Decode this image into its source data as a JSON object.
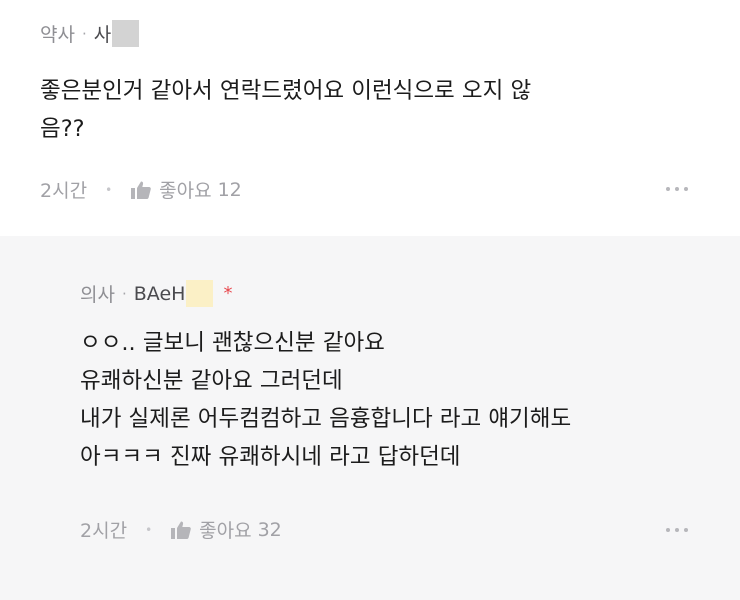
{
  "comment": {
    "role": "약사",
    "nickname": "사",
    "body_lines": [
      "좋은분인거 같아서 연락드렸어요  이런식으로 오지 않",
      "음??"
    ],
    "time": "2시간",
    "like_label": "좋아요",
    "like_count": "12"
  },
  "reply": {
    "role": "의사",
    "nickname": "BAeH",
    "author_mark": "*",
    "body_lines": [
      "ㅇㅇ.. 글보니 괜찮으신분 같아요",
      "유쾌하신분 같아요 그러던데",
      "내가 실제론 어두컴컴하고 음흉합니다 라고 얘기해도",
      "아ㅋㅋㅋ 진짜 유쾌하시네 라고 답하던데"
    ],
    "time": "2시간",
    "like_label": "좋아요",
    "like_count": "32"
  },
  "colors": {
    "reply_background": "#f6f6f7",
    "meta_gray": "#8f8f94",
    "author_mark_red": "#e8484e",
    "mask_gray": "#d3d3d3",
    "mask_yellow": "#fbf0c6"
  },
  "icons": {
    "like": "thumbs-up-icon",
    "more": "more-dots-icon"
  }
}
